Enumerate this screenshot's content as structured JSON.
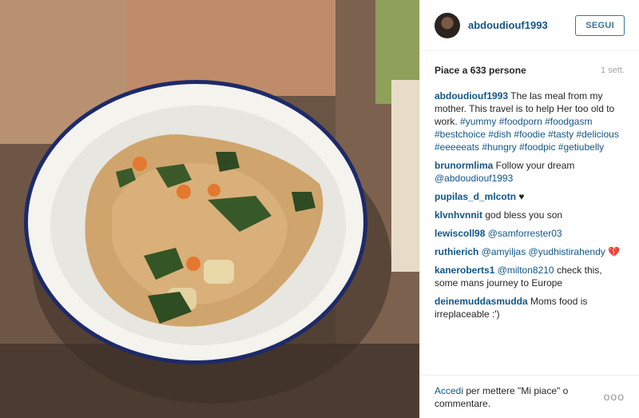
{
  "post": {
    "username": "abdoudiouf1993",
    "follow_label": "SEGUI",
    "likes_text": "Piace a 633 persone",
    "time_ago": "1 sett."
  },
  "caption": {
    "username": "abdoudiouf1993",
    "text": " The las meal from my mother. This travel is to help Her too old to work. ",
    "hashtags": "#yummy #foodporn #foodgasm #bestchoice #dish #foodie #tasty #delicious #eeeeeats #hungry #foodpic #getiubelly"
  },
  "comments": [
    {
      "user": "brunormlima",
      "text": " Follow your dream ",
      "mention": "@abdoudiouf1993"
    },
    {
      "user": "pupilas_d_mlcotn",
      "text": " ♥"
    },
    {
      "user": "klvnhvnnit",
      "text": " god bless you son"
    },
    {
      "user": "lewiscoll98",
      "mention": " @samforrester03"
    },
    {
      "user": "ruthierich",
      "mention": " @amyiljas @yudhistirahendy",
      "text": " 💔"
    },
    {
      "user": "kaneroberts1",
      "mention": " @milton8210",
      "text": " check this, some mans journey to Europe"
    },
    {
      "user": "deinemuddasmudda",
      "text": " Moms food is irreplaceable :')"
    }
  ],
  "footer": {
    "login_link": "Accedi",
    "login_text": " per mettere \"Mi piace\" o commentare.",
    "more_label": "ooo"
  },
  "colors": {
    "link": "#125688",
    "follow_border": "#3f729b",
    "text": "#262626",
    "muted": "#a5a7aa"
  }
}
